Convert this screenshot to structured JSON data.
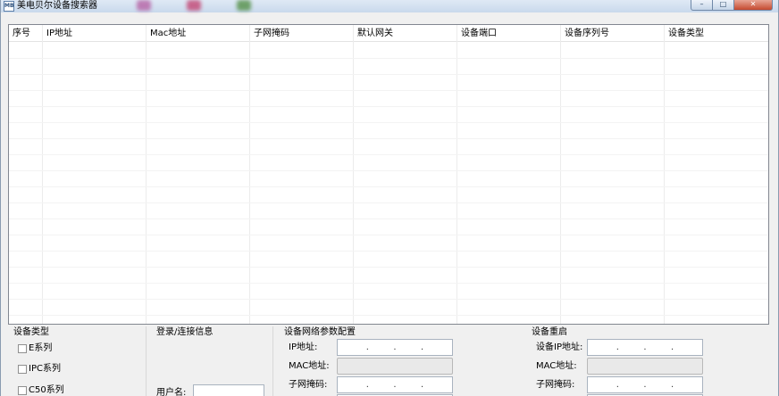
{
  "window": {
    "title": "美电贝尔设备搜索器",
    "icon_text": "MB",
    "controls": {
      "minimize": "–",
      "maximize": "□",
      "close": "✕"
    },
    "taskbar_blur_colors": [
      "#b45aa0",
      "#c23b6b",
      "#4b8a3c"
    ]
  },
  "grid": {
    "columns": [
      "序号",
      "IP地址",
      "Mac地址",
      "子网掩码",
      "默认网关",
      "设备端口",
      "设备序列号",
      "设备类型"
    ],
    "rows": []
  },
  "device_type": {
    "title": "设备类型",
    "options": [
      "E系列",
      "IPC系列",
      "C50系列"
    ]
  },
  "login": {
    "title": "登录/连接信息",
    "username_label": "用户名:"
  },
  "net_config": {
    "title": "设备网络参数配置",
    "ip_label": "IP地址:",
    "mac_label": "MAC地址:",
    "mask_label": "子网掩码:",
    "dot": "."
  },
  "reboot": {
    "title": "设备重启",
    "ip_label": "设备IP地址:",
    "mac_label": "MAC地址:",
    "mask_label": "子网掩码:"
  }
}
